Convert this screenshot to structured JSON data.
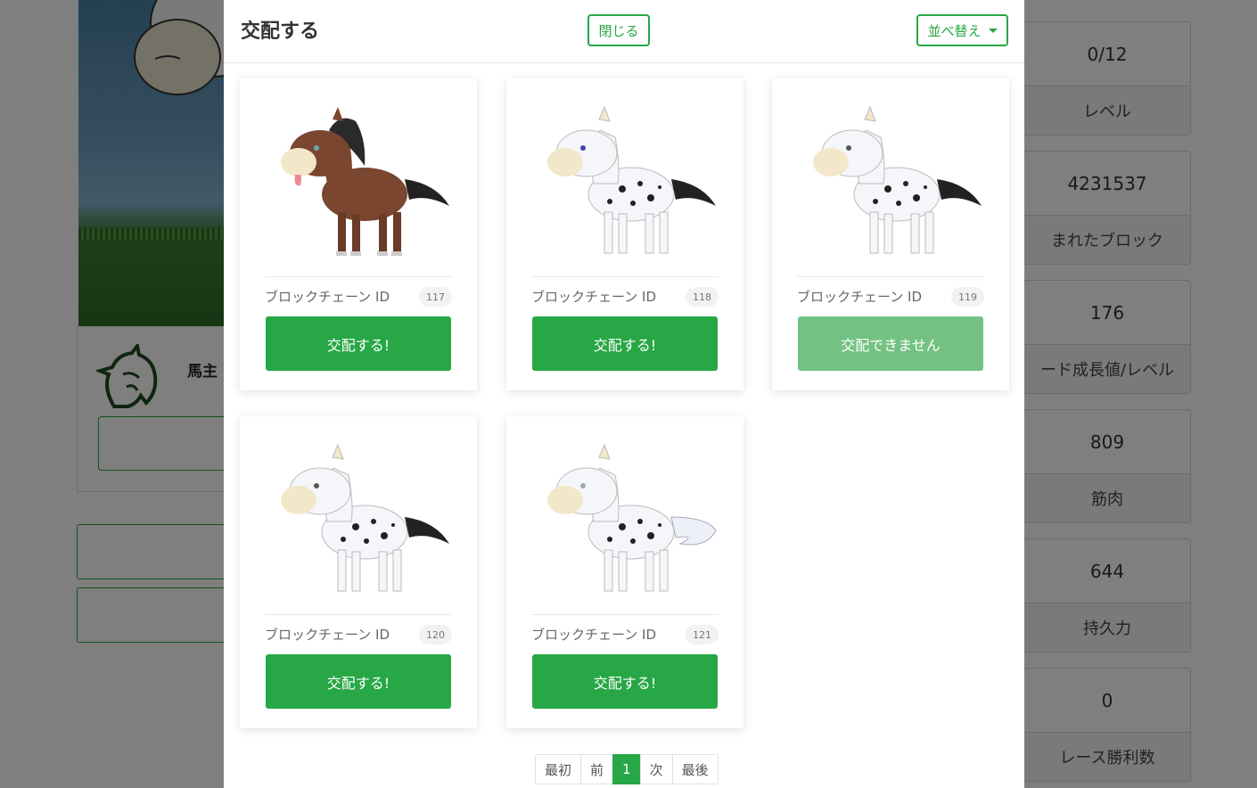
{
  "modal": {
    "title": "交配する",
    "close_label": "閉じる",
    "sort_label": "並べ替え",
    "accent_color": "#27a745"
  },
  "cards": [
    {
      "id_label": "ブロックチェーン ID",
      "id": "117",
      "button": "交配する!",
      "enabled": true,
      "horse": "brown-horse"
    },
    {
      "id_label": "ブロックチェーン ID",
      "id": "118",
      "button": "交配する!",
      "enabled": true,
      "horse": "spotted-horse"
    },
    {
      "id_label": "ブロックチェーン ID",
      "id": "119",
      "button": "交配できません",
      "enabled": false,
      "horse": "spotted-horse"
    },
    {
      "id_label": "ブロックチェーン ID",
      "id": "120",
      "button": "交配する!",
      "enabled": true,
      "horse": "spotted-horse"
    },
    {
      "id_label": "ブロックチェーン ID",
      "id": "121",
      "button": "交配する!",
      "enabled": true,
      "horse": "spotted-horse-white-tail"
    }
  ],
  "pagination": {
    "first": "最初",
    "prev": "前",
    "current": "1",
    "next": "次",
    "last": "最後"
  },
  "background": {
    "owner_label": "馬主",
    "stats": [
      {
        "value": "0/12",
        "label": "レベル"
      },
      {
        "value": "4231537",
        "label": "まれたブロック"
      },
      {
        "value": "176",
        "label": "ード成長値/レベル"
      },
      {
        "value": "809",
        "label": "筋肉"
      },
      {
        "value": "644",
        "label": "持久力"
      },
      {
        "value": "0",
        "label": "レース勝利数"
      }
    ]
  }
}
